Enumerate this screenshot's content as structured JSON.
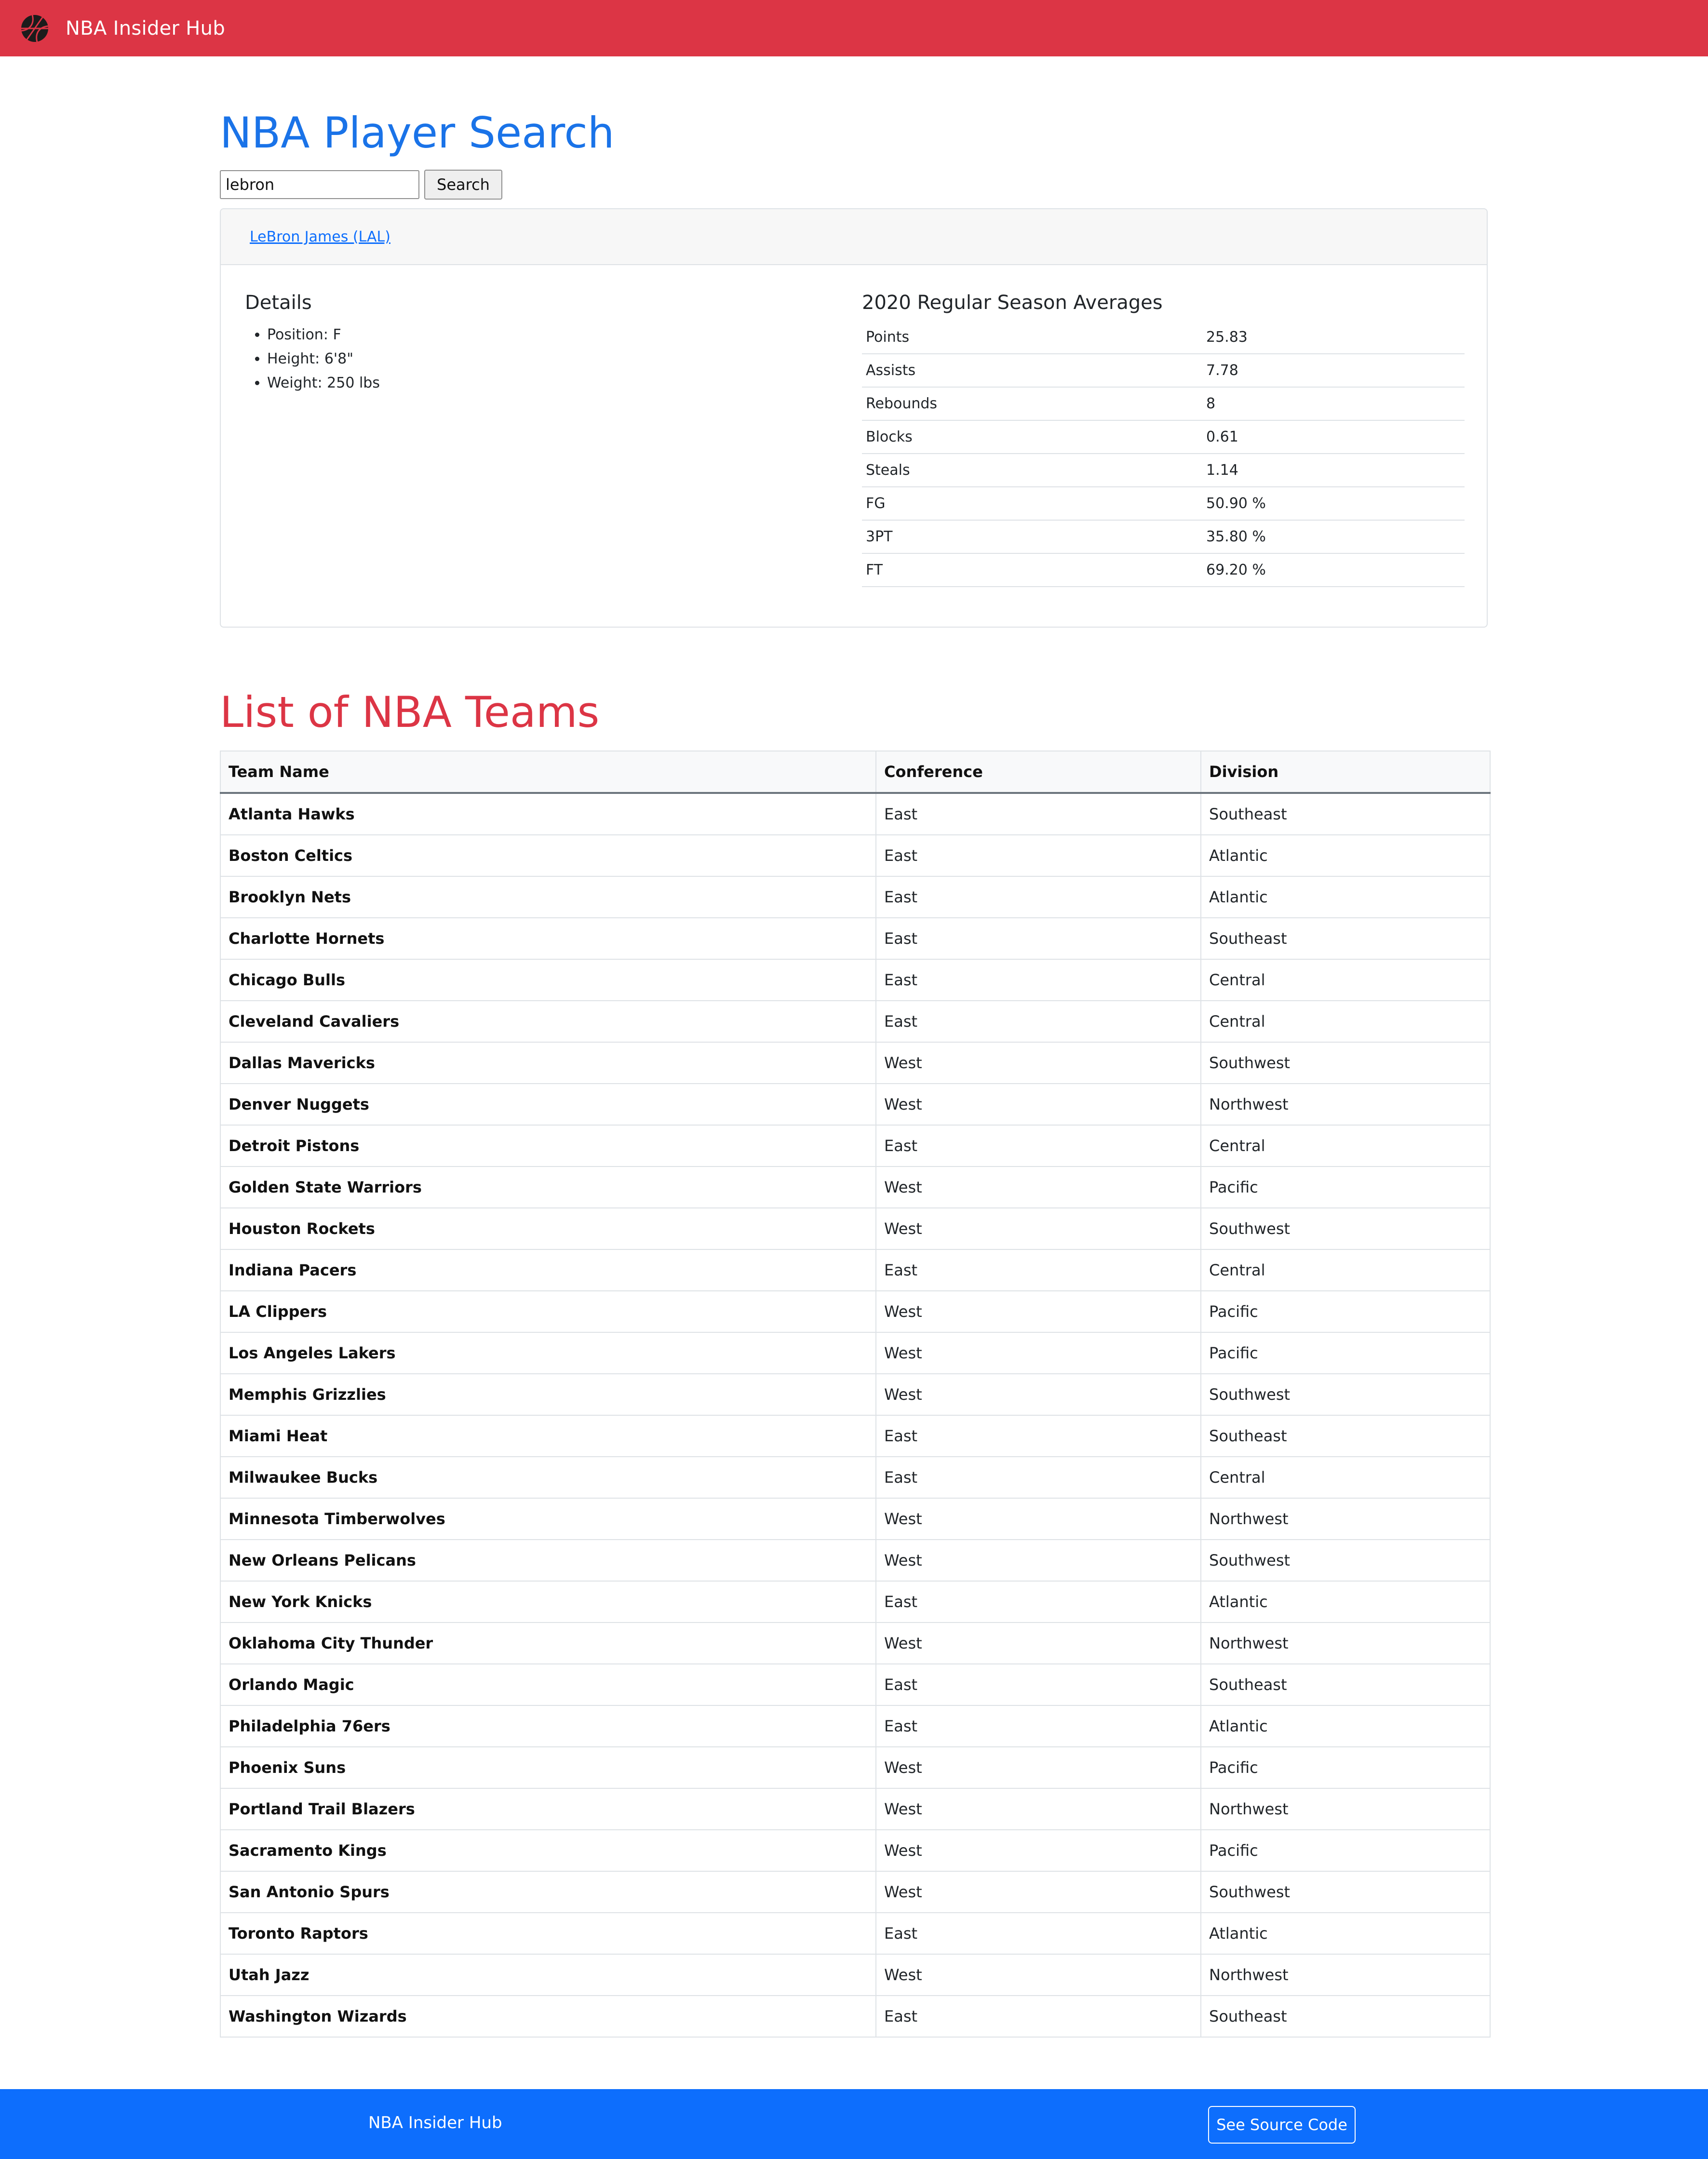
{
  "navbar": {
    "brand_name": "NBA Insider Hub",
    "logo_icon": "basketball-icon",
    "colors": {
      "background": "#dc3545",
      "text": "#ffffff"
    }
  },
  "player_search": {
    "title": "NBA Player Search",
    "search_input_value": "lebron",
    "search_button_label": "Search",
    "result_link": "LeBron James (LAL)",
    "details": {
      "heading": "Details",
      "items": [
        "Position: F",
        "Height: 6'8\"",
        "Weight: 250 lbs"
      ]
    },
    "averages": {
      "heading": "2020 Regular Season Averages",
      "rows": [
        {
          "label": "Points",
          "value": "25.83"
        },
        {
          "label": "Assists",
          "value": "7.78"
        },
        {
          "label": "Rebounds",
          "value": "8"
        },
        {
          "label": "Blocks",
          "value": "0.61"
        },
        {
          "label": "Steals",
          "value": "1.14"
        },
        {
          "label": "FG",
          "value": "50.90 %"
        },
        {
          "label": "3PT",
          "value": "35.80 %"
        },
        {
          "label": "FT",
          "value": "69.20 %"
        }
      ]
    },
    "title_color": "#1a73e8"
  },
  "teams": {
    "title": "List of NBA Teams",
    "title_color": "#dc3545",
    "headers": [
      "Team Name",
      "Conference",
      "Division"
    ],
    "rows": [
      [
        "Atlanta Hawks",
        "East",
        "Southeast"
      ],
      [
        "Boston Celtics",
        "East",
        "Atlantic"
      ],
      [
        "Brooklyn Nets",
        "East",
        "Atlantic"
      ],
      [
        "Charlotte Hornets",
        "East",
        "Southeast"
      ],
      [
        "Chicago Bulls",
        "East",
        "Central"
      ],
      [
        "Cleveland Cavaliers",
        "East",
        "Central"
      ],
      [
        "Dallas Mavericks",
        "West",
        "Southwest"
      ],
      [
        "Denver Nuggets",
        "West",
        "Northwest"
      ],
      [
        "Detroit Pistons",
        "East",
        "Central"
      ],
      [
        "Golden State Warriors",
        "West",
        "Pacific"
      ],
      [
        "Houston Rockets",
        "West",
        "Southwest"
      ],
      [
        "Indiana Pacers",
        "East",
        "Central"
      ],
      [
        "LA Clippers",
        "West",
        "Pacific"
      ],
      [
        "Los Angeles Lakers",
        "West",
        "Pacific"
      ],
      [
        "Memphis Grizzlies",
        "West",
        "Southwest"
      ],
      [
        "Miami Heat",
        "East",
        "Southeast"
      ],
      [
        "Milwaukee Bucks",
        "East",
        "Central"
      ],
      [
        "Minnesota Timberwolves",
        "West",
        "Northwest"
      ],
      [
        "New Orleans Pelicans",
        "West",
        "Southwest"
      ],
      [
        "New York Knicks",
        "East",
        "Atlantic"
      ],
      [
        "Oklahoma City Thunder",
        "West",
        "Northwest"
      ],
      [
        "Orlando Magic",
        "East",
        "Southeast"
      ],
      [
        "Philadelphia 76ers",
        "East",
        "Atlantic"
      ],
      [
        "Phoenix Suns",
        "West",
        "Pacific"
      ],
      [
        "Portland Trail Blazers",
        "West",
        "Northwest"
      ],
      [
        "Sacramento Kings",
        "West",
        "Pacific"
      ],
      [
        "San Antonio Spurs",
        "West",
        "Southwest"
      ],
      [
        "Toronto Raptors",
        "East",
        "Atlantic"
      ],
      [
        "Utah Jazz",
        "West",
        "Northwest"
      ],
      [
        "Washington Wizards",
        "East",
        "Southeast"
      ]
    ]
  },
  "footer": {
    "brand_name": "NBA Insider Hub",
    "source_button_label": "See Source Code",
    "background": "#0d6efd"
  }
}
